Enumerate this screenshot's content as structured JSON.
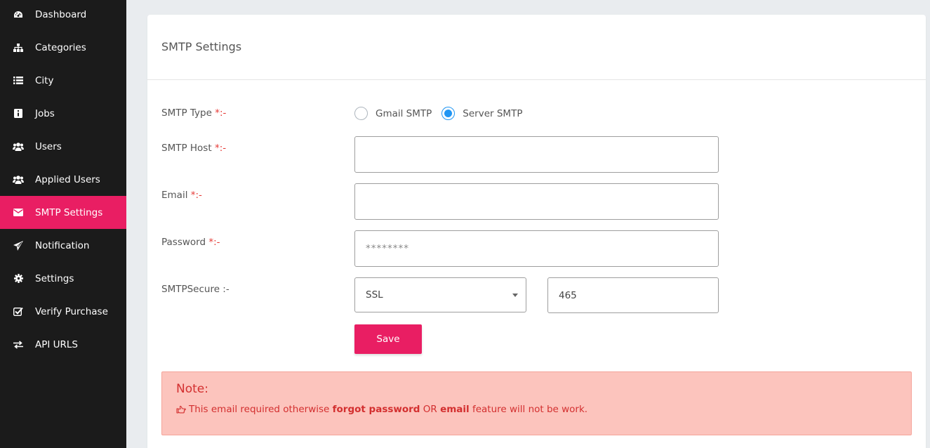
{
  "sidebar": {
    "items": [
      {
        "label": "Dashboard",
        "icon": "dashboard-icon"
      },
      {
        "label": "Categories",
        "icon": "sitemap-icon"
      },
      {
        "label": "City",
        "icon": "list-icon"
      },
      {
        "label": "Jobs",
        "icon": "info-icon"
      },
      {
        "label": "Users",
        "icon": "users-icon"
      },
      {
        "label": "Applied Users",
        "icon": "users-icon"
      },
      {
        "label": "SMTP Settings",
        "icon": "envelope-icon",
        "active": true
      },
      {
        "label": "Notification",
        "icon": "paper-plane-icon"
      },
      {
        "label": "Settings",
        "icon": "gear-icon"
      },
      {
        "label": "Verify Purchase",
        "icon": "check-square-icon"
      },
      {
        "label": "API URLS",
        "icon": "exchange-icon"
      }
    ],
    "active_color": "#e91e63",
    "background": "#1b1b1b"
  },
  "card": {
    "title": "SMTP Settings"
  },
  "form": {
    "smtp_type": {
      "label": "SMTP Type ",
      "required_mark": "*",
      "suffix": ":-",
      "options": [
        "Gmail SMTP",
        "Server SMTP"
      ],
      "selected": "Server SMTP"
    },
    "smtp_host": {
      "label": "SMTP Host ",
      "required_mark": "*",
      "suffix": ":-",
      "value": ""
    },
    "email": {
      "label": "Email ",
      "required_mark": "*",
      "suffix": ":-",
      "value": ""
    },
    "password": {
      "label": "Password ",
      "required_mark": "*",
      "suffix": ":-",
      "placeholder": "********"
    },
    "smtp_secure": {
      "label": "SMTPSecure :-",
      "selected": "SSL",
      "port": "465"
    },
    "save_label": "Save"
  },
  "note": {
    "title": "Note:",
    "text_1": "This email required otherwise ",
    "bold_1": "forgot password",
    "text_2": " OR ",
    "bold_2": "email",
    "text_3": " feature will not be work."
  }
}
